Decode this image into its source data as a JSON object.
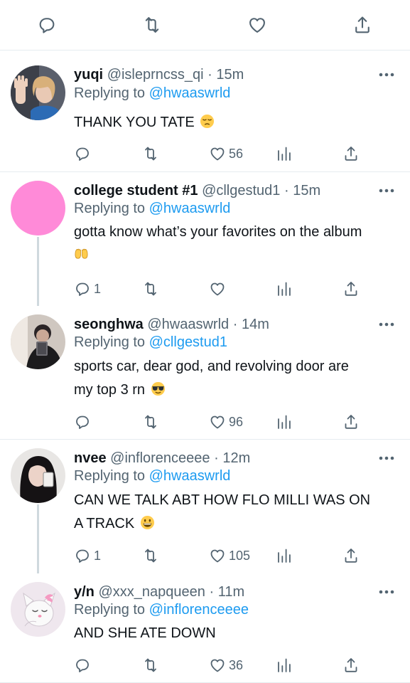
{
  "top_actions": {
    "reply_icon": "reply-icon",
    "retweet_icon": "retweet-icon",
    "like_icon": "heart-icon",
    "share_icon": "share-icon"
  },
  "tweets": [
    {
      "name": "yuqi",
      "handle": "@isleprncss_qi",
      "separator": "·",
      "time": "15m",
      "replying_prefix": "Replying to",
      "replying_to": "@hwaaswrld",
      "text": "THANK YOU TATE",
      "emoji": "😔",
      "replies": "",
      "likes": "56"
    },
    {
      "name": "college student #1",
      "handle": "@cllgestud1",
      "separator": "·",
      "time": "15m",
      "replying_prefix": "Replying to",
      "replying_to": "@hwaaswrld",
      "text": "gotta know what’s your favorites on the album",
      "emoji": "🤲",
      "replies": "1",
      "likes": ""
    },
    {
      "name": "seonghwa",
      "handle": "@hwaaswrld",
      "separator": "·",
      "time": "14m",
      "replying_prefix": "Replying to",
      "replying_to": "@cllgestud1",
      "text_line1": "sports car, dear god, and revolving door are",
      "text_line2": "my top 3 rn",
      "emoji": "😎",
      "replies": "",
      "likes": "96"
    },
    {
      "name": "nvee",
      "handle": "@inflorenceeee",
      "separator": "·",
      "time": "12m",
      "replying_prefix": "Replying to",
      "replying_to": "@hwaaswrld",
      "text_line1": "CAN WE TALK ABT HOW FLO MILLI WAS ON",
      "text_line2": "A TRACK",
      "emoji": "😀",
      "replies": "1",
      "likes": "105"
    },
    {
      "name": "y/n",
      "handle": "@xxx_napqueen",
      "separator": "·",
      "time": "11m",
      "replying_prefix": "Replying to",
      "replying_to": "@inflorenceeee",
      "text": "AND SHE ATE DOWN",
      "replies": "",
      "likes": "36"
    }
  ],
  "colors": {
    "link": "#1d9bf0",
    "muted": "#536471",
    "thread_line": "#cfd9de",
    "pink_avatar": "#ff8ad8"
  }
}
